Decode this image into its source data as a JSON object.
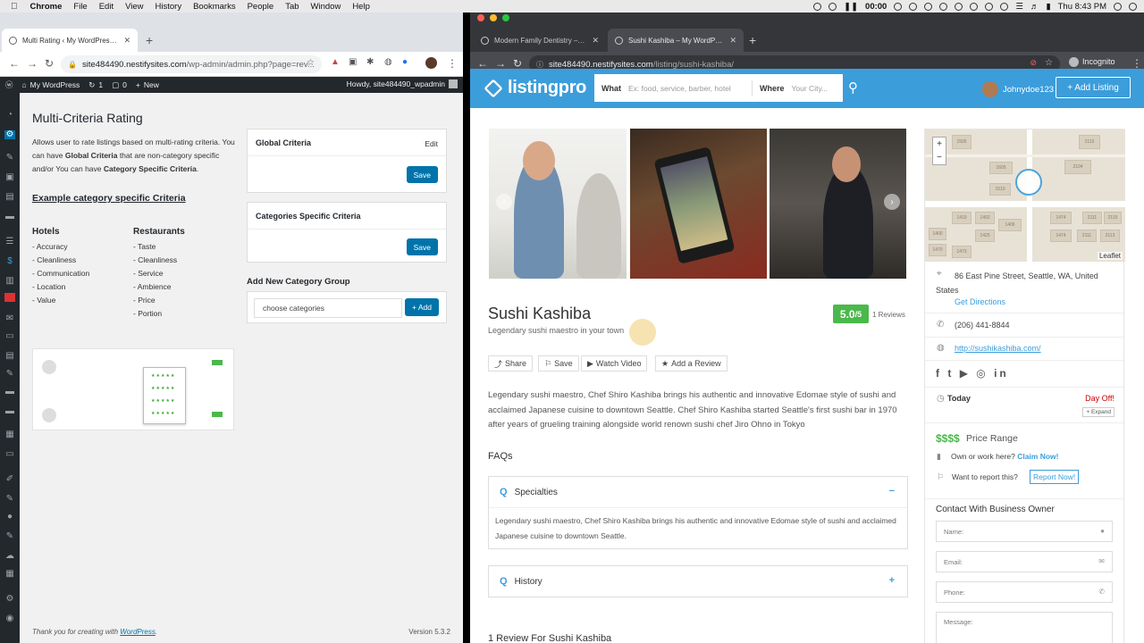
{
  "menubar": {
    "items": [
      "Chrome",
      "File",
      "Edit",
      "View",
      "History",
      "Bookmarks",
      "People",
      "Tab",
      "Window",
      "Help"
    ],
    "time": "00:00",
    "clock": "Thu 8:43 PM"
  },
  "left_window": {
    "tabs": [
      {
        "label": "Multi Rating ‹ My WordPress — W"
      }
    ],
    "url": "site484490.nestifysites.com",
    "url_path": "/wp-admin/admin.php?page=rev...",
    "adminbar": {
      "site": "My WordPress",
      "updates": "1",
      "comments": "0",
      "new": "New",
      "howdy": "Howdy, site484490_wpadmin"
    },
    "page": {
      "title": "Multi-Criteria Rating",
      "description_1": "Allows user to rate listings based on multi-rating criteria. You can have ",
      "description_bold_1": "Global Criteria",
      "description_2": " that are non-category specific and/or You can have ",
      "description_bold_2": "Category Specific Criteria",
      "description_3": ".",
      "example_heading": "Example category specific Criteria",
      "hotels": {
        "title": "Hotels",
        "items": [
          "- Accuracy",
          "- Cleanliness",
          "- Communication",
          "- Location",
          "- Value"
        ]
      },
      "restaurants": {
        "title": "Restaurants",
        "items": [
          "- Taste",
          "- Cleanliness",
          "- Service",
          "- Ambience",
          "- Price",
          "- Portion"
        ]
      },
      "global_criteria": {
        "title": "Global Criteria",
        "edit": "Edit",
        "save": "Save"
      },
      "category_criteria": {
        "title": "Categories Specific Criteria",
        "save": "Save"
      },
      "add_group": {
        "title": "Add New Category Group",
        "placeholder": "choose categories",
        "button": "+ Add"
      },
      "footer": {
        "text": "Thank you for creating with ",
        "link": "WordPress",
        "after": ".",
        "version": "Version 5.3.2"
      }
    }
  },
  "right_window": {
    "tabs": [
      {
        "label": "Modern Family Dentistry – Place"
      },
      {
        "label": "Sushi Kashiba – My WordPress"
      }
    ],
    "url": "site484490.nestifysites.com",
    "url_path": "/listing/sushi-kashiba/",
    "incognito": "Incognito",
    "header": {
      "logo": "listingpro",
      "what_label": "What",
      "what_placeholder": "Ex: food, service, barber, hotel",
      "where_label": "Where",
      "where_placeholder": "Your City...",
      "username": "Johnydoe123",
      "add_listing": "+ Add Listing"
    },
    "listing": {
      "title": "Sushi Kashiba",
      "tagline": "Legendary sushi maestro in your town",
      "rating": "5.0",
      "rating_max": "/5",
      "reviews": "1 Reviews",
      "actions": [
        "Share",
        "Save",
        "Watch Video",
        "Add a Review"
      ],
      "description": "Legendary sushi maestro, Chef Shiro Kashiba brings his authentic and innovative Edomae style of sushi and acclaimed Japanese cuisine to downtown Seattle. Chef Shiro Kashiba started Seattle's first sushi bar in 1970 after years of grueling training alongside world renown sushi chef Jiro Ohno in Tokyo",
      "faqs_title": "FAQs",
      "faqs": [
        {
          "q": "Specialties",
          "toggle": "−",
          "a": "Legendary sushi maestro, Chef Shiro Kashiba brings his authentic and innovative Edomae style of sushi and acclaimed Japanese cuisine to downtown Seattle."
        },
        {
          "q": "History",
          "toggle": "+"
        }
      ],
      "review_heading": "1 Review For Sushi Kashiba"
    },
    "sidebar": {
      "map_attribution": "Leaflet",
      "map_labels": [
        "1505",
        "1605",
        "1510",
        "2104",
        "1474",
        "1419",
        "1402",
        "1400",
        "1406",
        "2111",
        "2115",
        "2113",
        "2111",
        "1474",
        "1425",
        "1473",
        "1470",
        "2110"
      ],
      "address": "86 East Pine Street, Seattle, WA, United States",
      "directions": "Get Directions",
      "phone": "(206) 441-8844",
      "website": "http://sushikashiba.com/",
      "today": "Today",
      "day_off": "Day Off!",
      "expand": "+ Expand",
      "price_symbols": "$$$$",
      "price_range": "Price Range",
      "claim_text": "Own or work here?",
      "claim_link": "Claim Now!",
      "report_text": "Want to report this?",
      "report_button": "Report Now!",
      "contact_title": "Contact With Business Owner",
      "fields": [
        "Name:",
        "Email:",
        "Phone:",
        "Message:"
      ]
    }
  },
  "colors": {
    "brand_blue": "#3c9ddb",
    "wp_blue": "#0073aa",
    "rating_green": "#4bb84b",
    "wp_dark": "#23282d"
  }
}
